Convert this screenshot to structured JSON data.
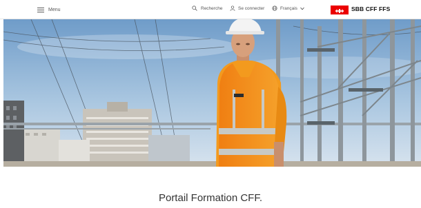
{
  "header": {
    "menu_label": "Menu",
    "search_label": "Recherche",
    "login_label": "Se connecter",
    "language_label": "Français",
    "logo_text": "SBB CFF FFS",
    "icons": {
      "menu": "hamburger-icon",
      "search": "search-icon",
      "login": "user-icon",
      "language": "globe-icon",
      "dropdown": "chevron-down-icon"
    },
    "brand_color": "#eb0000"
  },
  "hero": {
    "image_alt": "Worker in orange safety vest on railway"
  },
  "main": {
    "title": "Portail Formation CFF."
  }
}
